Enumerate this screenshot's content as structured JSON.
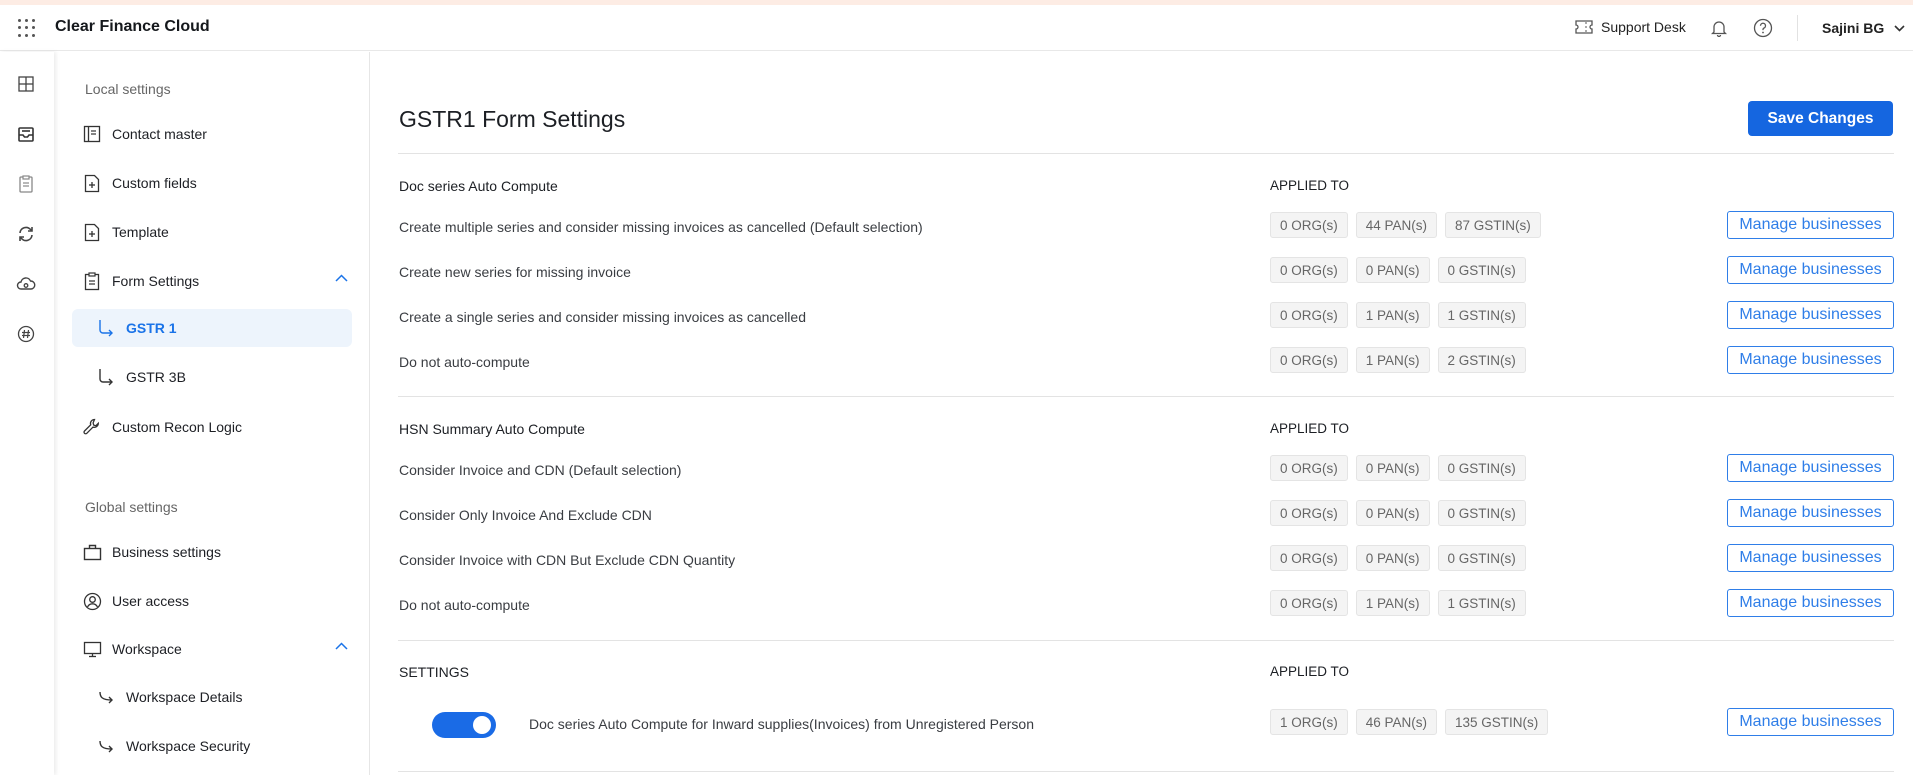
{
  "header": {
    "brand": "Clear Finance Cloud",
    "support": "Support Desk",
    "user": "Sajini BG"
  },
  "rail": {
    "icons": [
      "dashboard-icon",
      "inbox-icon",
      "clipboard-icon",
      "sync-icon",
      "cloud-icon",
      "hash-icon"
    ]
  },
  "sidebar": {
    "local_title": "Local settings",
    "global_title": "Global settings",
    "items": {
      "contact_master": "Contact master",
      "custom_fields": "Custom fields",
      "template": "Template",
      "form_settings": "Form Settings",
      "gstr1": "GSTR 1",
      "gstr3b": "GSTR 3B",
      "custom_recon": "Custom Recon Logic",
      "business_settings": "Business settings",
      "user_access": "User access",
      "workspace": "Workspace",
      "workspace_details": "Workspace Details",
      "workspace_security": "Workspace Security"
    }
  },
  "main": {
    "title": "GSTR1 Form Settings",
    "save_label": "Save Changes",
    "manage_label": "Manage businesses",
    "applied_to": "APPLIED TO",
    "doc_series": {
      "title": "Doc series Auto Compute",
      "rows": [
        {
          "label": "Create multiple series and consider missing invoices as cancelled (Default selection)",
          "org": "0 ORG(s)",
          "pan": "44 PAN(s)",
          "gstin": "87 GSTIN(s)"
        },
        {
          "label": "Create new series for missing invoice",
          "org": "0 ORG(s)",
          "pan": "0 PAN(s)",
          "gstin": "0 GSTIN(s)"
        },
        {
          "label": "Create a single series and consider missing invoices as cancelled",
          "org": "0 ORG(s)",
          "pan": "1 PAN(s)",
          "gstin": "1 GSTIN(s)"
        },
        {
          "label": "Do not auto-compute",
          "org": "0 ORG(s)",
          "pan": "1 PAN(s)",
          "gstin": "2 GSTIN(s)"
        }
      ]
    },
    "hsn": {
      "title": "HSN Summary Auto Compute",
      "rows": [
        {
          "label": "Consider Invoice and CDN (Default selection)",
          "org": "0 ORG(s)",
          "pan": "0 PAN(s)",
          "gstin": "0 GSTIN(s)"
        },
        {
          "label": "Consider Only Invoice And Exclude CDN",
          "org": "0 ORG(s)",
          "pan": "0 PAN(s)",
          "gstin": "0 GSTIN(s)"
        },
        {
          "label": "Consider Invoice with CDN But Exclude CDN Quantity",
          "org": "0 ORG(s)",
          "pan": "0 PAN(s)",
          "gstin": "0 GSTIN(s)"
        },
        {
          "label": "Do not auto-compute",
          "org": "0 ORG(s)",
          "pan": "1 PAN(s)",
          "gstin": "1 GSTIN(s)"
        }
      ]
    },
    "settings": {
      "title": "SETTINGS",
      "toggle_on": true,
      "row": {
        "label": "Doc series Auto Compute for Inward supplies(Invoices) from Unregistered Person",
        "org": "1 ORG(s)",
        "pan": "46 PAN(s)",
        "gstin": "135 GSTIN(s)"
      }
    }
  },
  "colors": {
    "accent": "#1566e0",
    "active_bg": "#edf4fc"
  }
}
